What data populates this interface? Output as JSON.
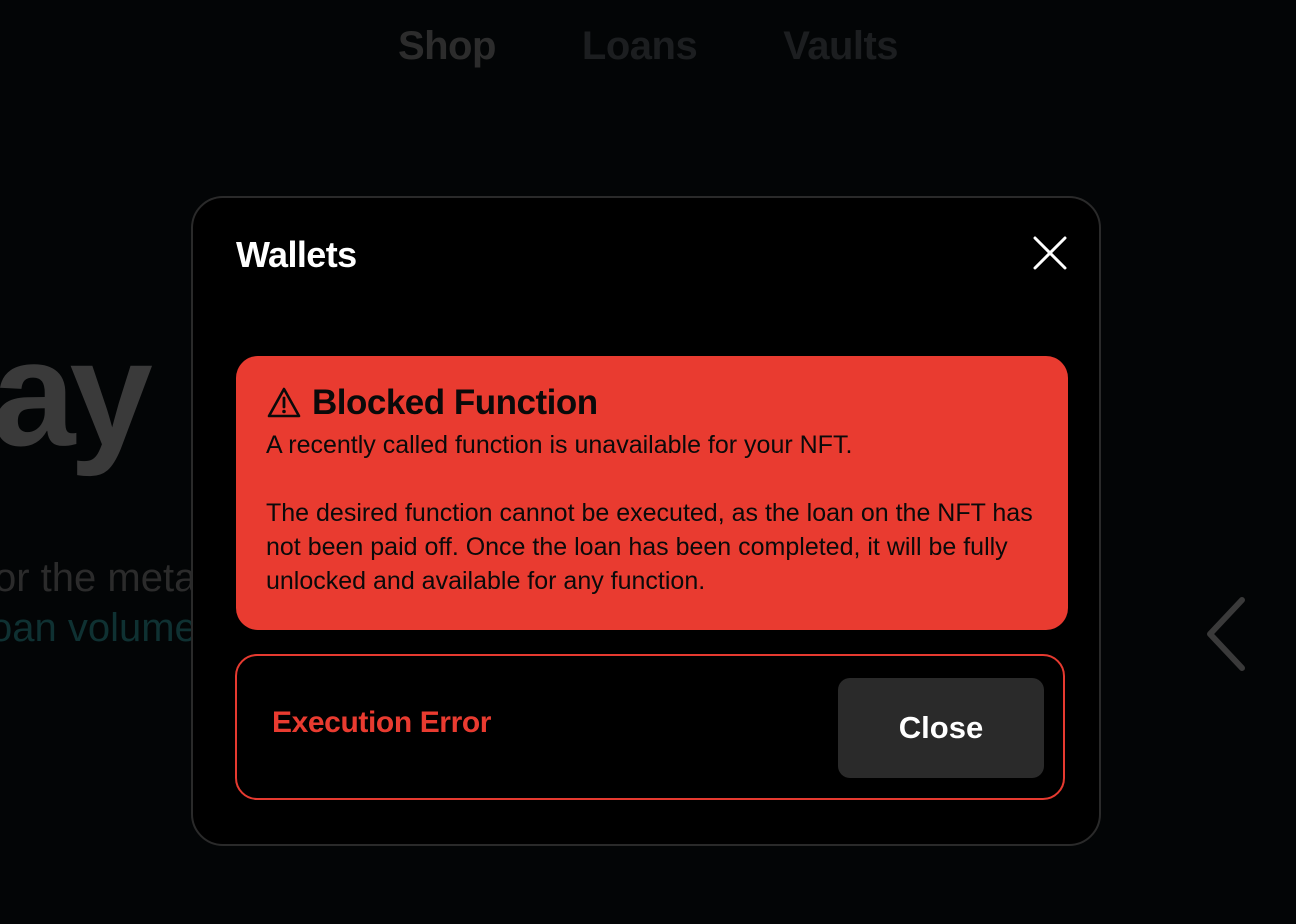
{
  "nav": {
    "items": [
      {
        "label": "Shop"
      },
      {
        "label": "Loans"
      },
      {
        "label": "Vaults"
      }
    ]
  },
  "hero": {
    "word_fragment": "ay",
    "sub_line_1": "or the meta",
    "sub_line_2": "oan volume"
  },
  "modal": {
    "title": "Wallets",
    "alert": {
      "icon": "warning-triangle-icon",
      "title": "Blocked Function",
      "line1": "A recently called function is unavailable for your NFT.",
      "body": "The desired function cannot be executed, as the loan on the NFT has not been paid off. Once the loan has been completed, it will be fully unlocked and available for any function."
    },
    "error": {
      "label": "Execution Error",
      "close_label": "Close"
    }
  },
  "colors": {
    "background": "#030506",
    "alert_red": "#e93b30",
    "button_bg": "#2a2a2a",
    "modal_border": "#2a2a2a"
  }
}
